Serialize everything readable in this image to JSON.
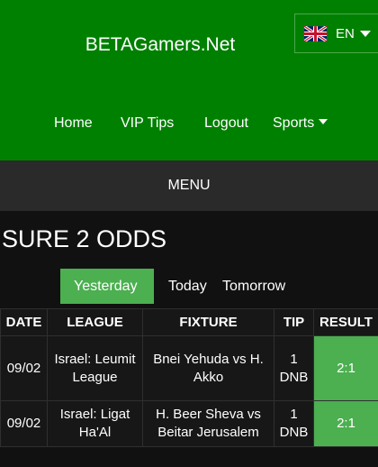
{
  "header": {
    "site_title": "BETAGamers.Net",
    "language": {
      "label": "EN",
      "flag_icon": "uk-flag-icon"
    },
    "nav": [
      {
        "label": "Home"
      },
      {
        "label": "VIP Tips"
      },
      {
        "label": "Logout"
      },
      {
        "label": "Sports",
        "has_dropdown": true
      }
    ]
  },
  "menu_label": "MENU",
  "section_title": "SURE 2 ODDS",
  "tabs": [
    {
      "label": "Yesterday",
      "active": true
    },
    {
      "label": "Today",
      "active": false
    },
    {
      "label": "Tomorrow",
      "active": false
    }
  ],
  "table": {
    "columns": [
      "DATE",
      "LEAGUE",
      "FIXTURE",
      "TIP",
      "RESULT"
    ],
    "rows": [
      {
        "date": "09/02",
        "league": "Israel: Leumit League",
        "fixture": "Bnei Yehuda vs H. Akko",
        "tip": "1 DNB",
        "result": "2:1"
      },
      {
        "date": "09/02",
        "league": "Israel: Ligat Ha'Al",
        "fixture": "H. Beer Sheva vs Beitar Jerusalem",
        "tip": "1 DNB",
        "result": "2:1"
      }
    ]
  },
  "colors": {
    "header_bg": "#008000",
    "menu_bg": "#2a2a2a",
    "page_bg": "#111111",
    "accent_green": "#4caf50"
  }
}
